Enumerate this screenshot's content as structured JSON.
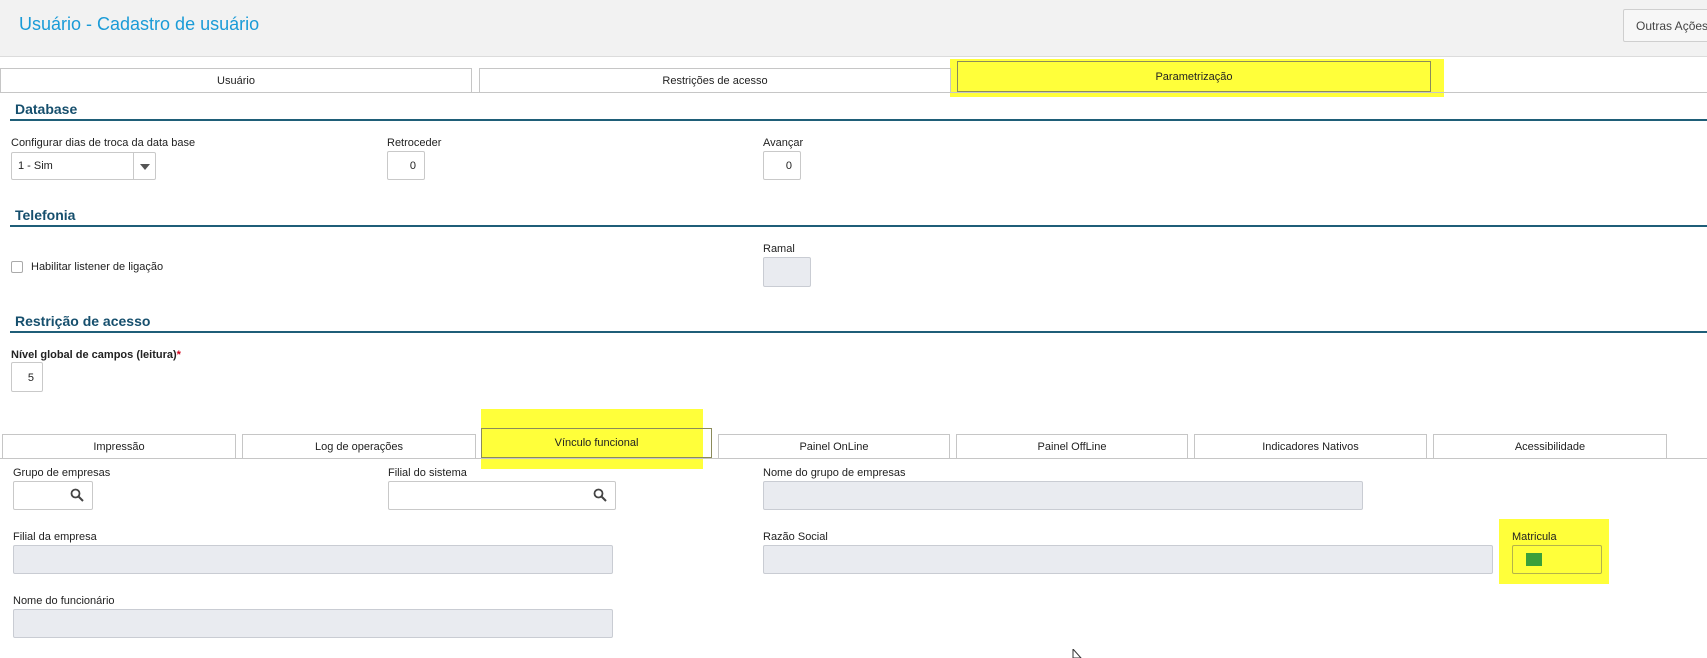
{
  "header": {
    "title": "Usuário - Cadastro de usuário",
    "more_actions": "Outras Ações"
  },
  "main_tabs": [
    {
      "label": "Usuário"
    },
    {
      "label": "Restrições de acesso"
    },
    {
      "label": "Parametrização",
      "active": true
    }
  ],
  "database": {
    "title": "Database",
    "config_label": "Configurar dias de troca da data base",
    "config_value": "1 - Sim",
    "retroceder_label": "Retroceder",
    "retroceder_value": "0",
    "avancar_label": "Avançar",
    "avancar_value": "0"
  },
  "telefonia": {
    "title": "Telefonia",
    "listener_label": "Habilitar listener de ligação",
    "ramal_label": "Ramal"
  },
  "restricao": {
    "title": "Restrição de acesso",
    "nivel_label": "Nível global de campos (leitura)",
    "required_mark": "*",
    "nivel_value": "5"
  },
  "sub_tabs": [
    {
      "label": "Impressão"
    },
    {
      "label": "Log de operações"
    },
    {
      "label": "Vínculo funcional",
      "active": true
    },
    {
      "label": "Painel OnLine"
    },
    {
      "label": "Painel OffLine"
    },
    {
      "label": "Indicadores Nativos"
    },
    {
      "label": "Acessibilidade"
    }
  ],
  "vinculo": {
    "grupo_label": "Grupo de empresas",
    "filial_sistema_label": "Filial do sistema",
    "nome_grupo_label": "Nome do grupo de empresas",
    "filial_empresa_label": "Filial da empresa",
    "razao_label": "Razão Social",
    "matricula_label": "Matricula",
    "nome_func_label": "Nome do funcionário"
  },
  "colors": {
    "title": "#1a9bd7",
    "section": "#164f6d",
    "highlight": "#ffff3a"
  }
}
